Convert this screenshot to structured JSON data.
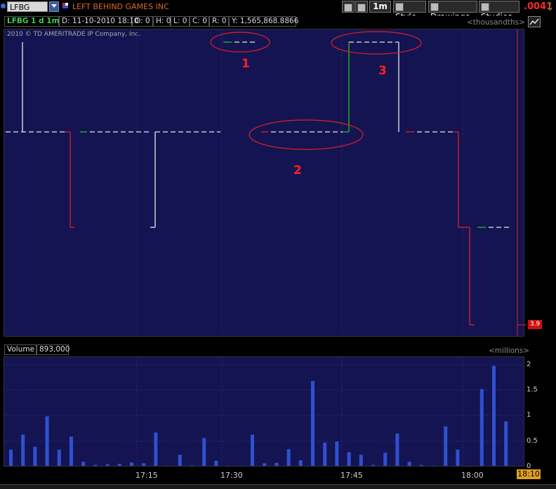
{
  "toolbar": {
    "symbol": "LFBG",
    "company_name": "LEFT BEHIND GAMES INC",
    "interval_label": "1m",
    "style_label": "Style",
    "drawings_label": "Drawings",
    "studies_label": "Studies",
    "last_price": ".0041"
  },
  "info_bar": {
    "chart_label": "LFBG 1 d 1m",
    "date": "D: 11-10-2010 18:10",
    "open": "O: 0",
    "high": "H: 0",
    "low": "L: 0",
    "close": "C: 0",
    "range": "R: 0",
    "y_value": "Y: 1,565,868.8866",
    "units": "<thousandths>"
  },
  "copyright": "2010 © TD AMERITRADE IP Company, Inc.",
  "price_tag": "3.9",
  "volume_header": {
    "label": "Volume",
    "value": "893,000",
    "units": "<millions>"
  },
  "volume_axis_ticks": [
    "2",
    "1.5",
    "1",
    "0.5",
    "0"
  ],
  "time_axis_ticks": [
    "17:15",
    "17:30",
    "17:45",
    "18:00"
  ],
  "time_tag": "18:10",
  "annotations": [
    "1",
    "2",
    "3"
  ],
  "colors": {
    "panel_bg": "#141452",
    "up": "#20c020",
    "down": "#e02020",
    "flat": "#e8e8e8",
    "volume_bar": "#3050d0",
    "annotation": "#ff2020"
  },
  "chart_data": {
    "type": "bar",
    "title": "",
    "xlabel": "",
    "ylabel": "",
    "volume_millions": [
      0.32,
      0.62,
      0.38,
      0.98,
      0.32,
      0.58,
      0.08,
      0.02,
      0.03,
      0.04,
      0.07,
      0.05,
      0.66,
      0.0,
      0.22,
      0.01,
      0.55,
      0.1,
      0.0,
      0.0,
      0.62,
      0.05,
      0.06,
      0.33,
      0.11,
      1.68,
      0.46,
      0.48,
      0.27,
      0.22,
      0.02,
      0.26,
      0.64,
      0.08,
      0.02,
      0.0,
      0.78,
      0.32,
      0.0,
      1.52,
      1.98,
      0.88
    ],
    "ylim": [
      0,
      2
    ]
  }
}
